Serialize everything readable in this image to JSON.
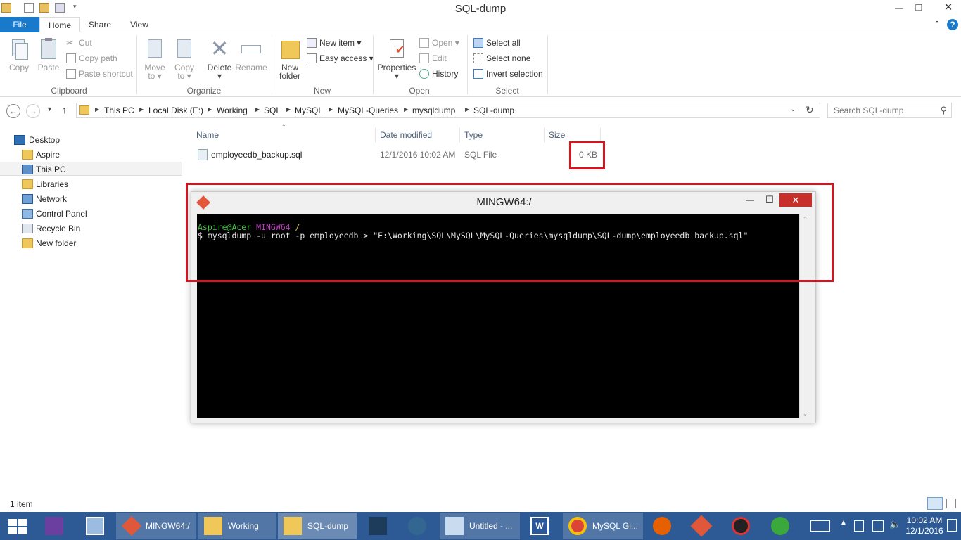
{
  "window": {
    "title": "SQL-dump"
  },
  "tabs": {
    "file": "File",
    "home": "Home",
    "share": "Share",
    "view": "View"
  },
  "ribbon": {
    "clipboard": {
      "copy": "Copy",
      "paste": "Paste",
      "cut": "Cut",
      "copy_path": "Copy path",
      "paste_shortcut": "Paste shortcut",
      "label": "Clipboard"
    },
    "organize": {
      "move_to": "Move",
      "move_to2": "to",
      "copy_to": "Copy",
      "copy_to2": "to",
      "delete": "Delete",
      "rename": "Rename",
      "label": "Organize"
    },
    "new": {
      "new_folder": "New",
      "new_folder2": "folder",
      "new_item": "New item",
      "easy_access": "Easy access",
      "label": "New"
    },
    "open": {
      "properties": "Properties",
      "open": "Open",
      "edit": "Edit",
      "history": "History",
      "label": "Open"
    },
    "select": {
      "select_all": "Select all",
      "select_none": "Select none",
      "invert": "Invert selection",
      "label": "Select"
    }
  },
  "address": {
    "crumbs": [
      "This PC",
      "Local Disk (E:)",
      "Working",
      "SQL",
      "MySQL",
      "MySQL-Queries",
      "mysqldump",
      "SQL-dump"
    ],
    "search_placeholder": "Search SQL-dump"
  },
  "nav": {
    "items": [
      "Desktop",
      "Aspire",
      "This PC",
      "Libraries",
      "Network",
      "Control Panel",
      "Recycle Bin",
      "New folder"
    ]
  },
  "columns": {
    "name": "Name",
    "date": "Date modified",
    "type": "Type",
    "size": "Size"
  },
  "files": [
    {
      "name": "employeedb_backup.sql",
      "date": "12/1/2016 10:02 AM",
      "type": "SQL File",
      "size": "0 KB"
    }
  ],
  "status": {
    "count": "1 item"
  },
  "terminal": {
    "title": "MINGW64:/",
    "user": "Aspire@Acer",
    "shell": "MINGW64",
    "path": "/",
    "command": "$ mysqldump -u root -p employeedb > \"E:\\Working\\SQL\\MySQL\\MySQL-Queries\\mysqldump\\SQL-dump\\employeedb_backup.sql\"",
    "colors": {
      "user": "#3fc43f",
      "shell": "#c040c0",
      "path": "#d8c23a"
    }
  },
  "taskbar": {
    "mingw": "MINGW64:/",
    "working": "Working",
    "sqldump": "SQL-dump",
    "untitled": "Untitled - ...",
    "mysql": "MySQL Gi...",
    "time": "10:02 AM",
    "date": "12/1/2016"
  },
  "colors": {
    "accent": "#1979ca",
    "annotation": "#d4151f",
    "taskbar": "#2d5a94"
  }
}
